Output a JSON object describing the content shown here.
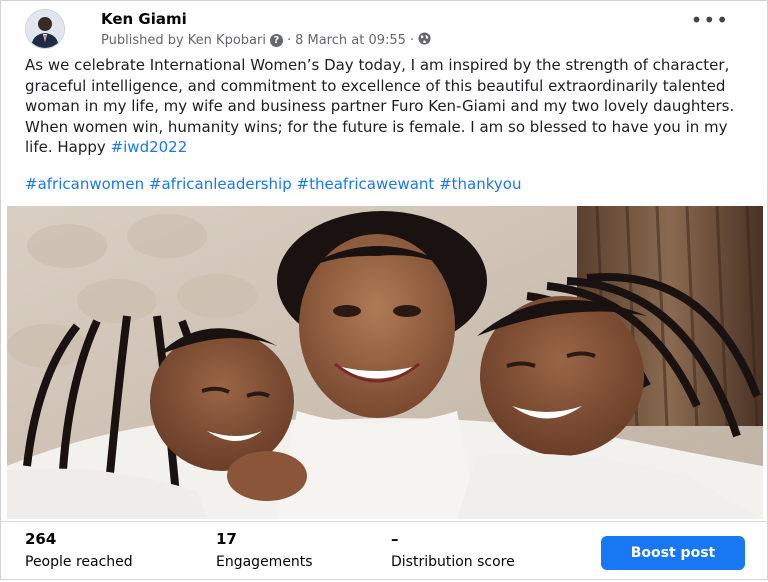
{
  "post": {
    "author": "Ken Giami",
    "published_by": "Published by Ken Kpobari",
    "timestamp": "8 March at 09:55",
    "separator": "·",
    "more_icon": "more-horizontal-icon",
    "privacy_icon": "globe-icon",
    "body_text": "As we celebrate International Women’s Day today, I am inspired by the strength of character, graceful intelligence, and commitment to excellence of this beautiful extraordinarily talented woman in my life, my wife and business partner Furo Ken-Giami and my two lovely daughters. When women win, humanity wins; for the future is female. I am so blessed to have you in my life. Happy",
    "inline_hashtag": "#iwd2022",
    "hashtags": [
      "#africanwomen",
      "#africanleadership",
      "#theafricawewant",
      "#thankyou"
    ]
  },
  "insights": {
    "reached_value": "264",
    "reached_label": "People reached",
    "engagements_value": "17",
    "engagements_label": "Engagements",
    "distribution_value": "–",
    "distribution_label": "Distribution score",
    "boost_label": "Boost post"
  },
  "colors": {
    "link": "#1877f2",
    "button": "#1877f2",
    "meta": "#65676b"
  }
}
